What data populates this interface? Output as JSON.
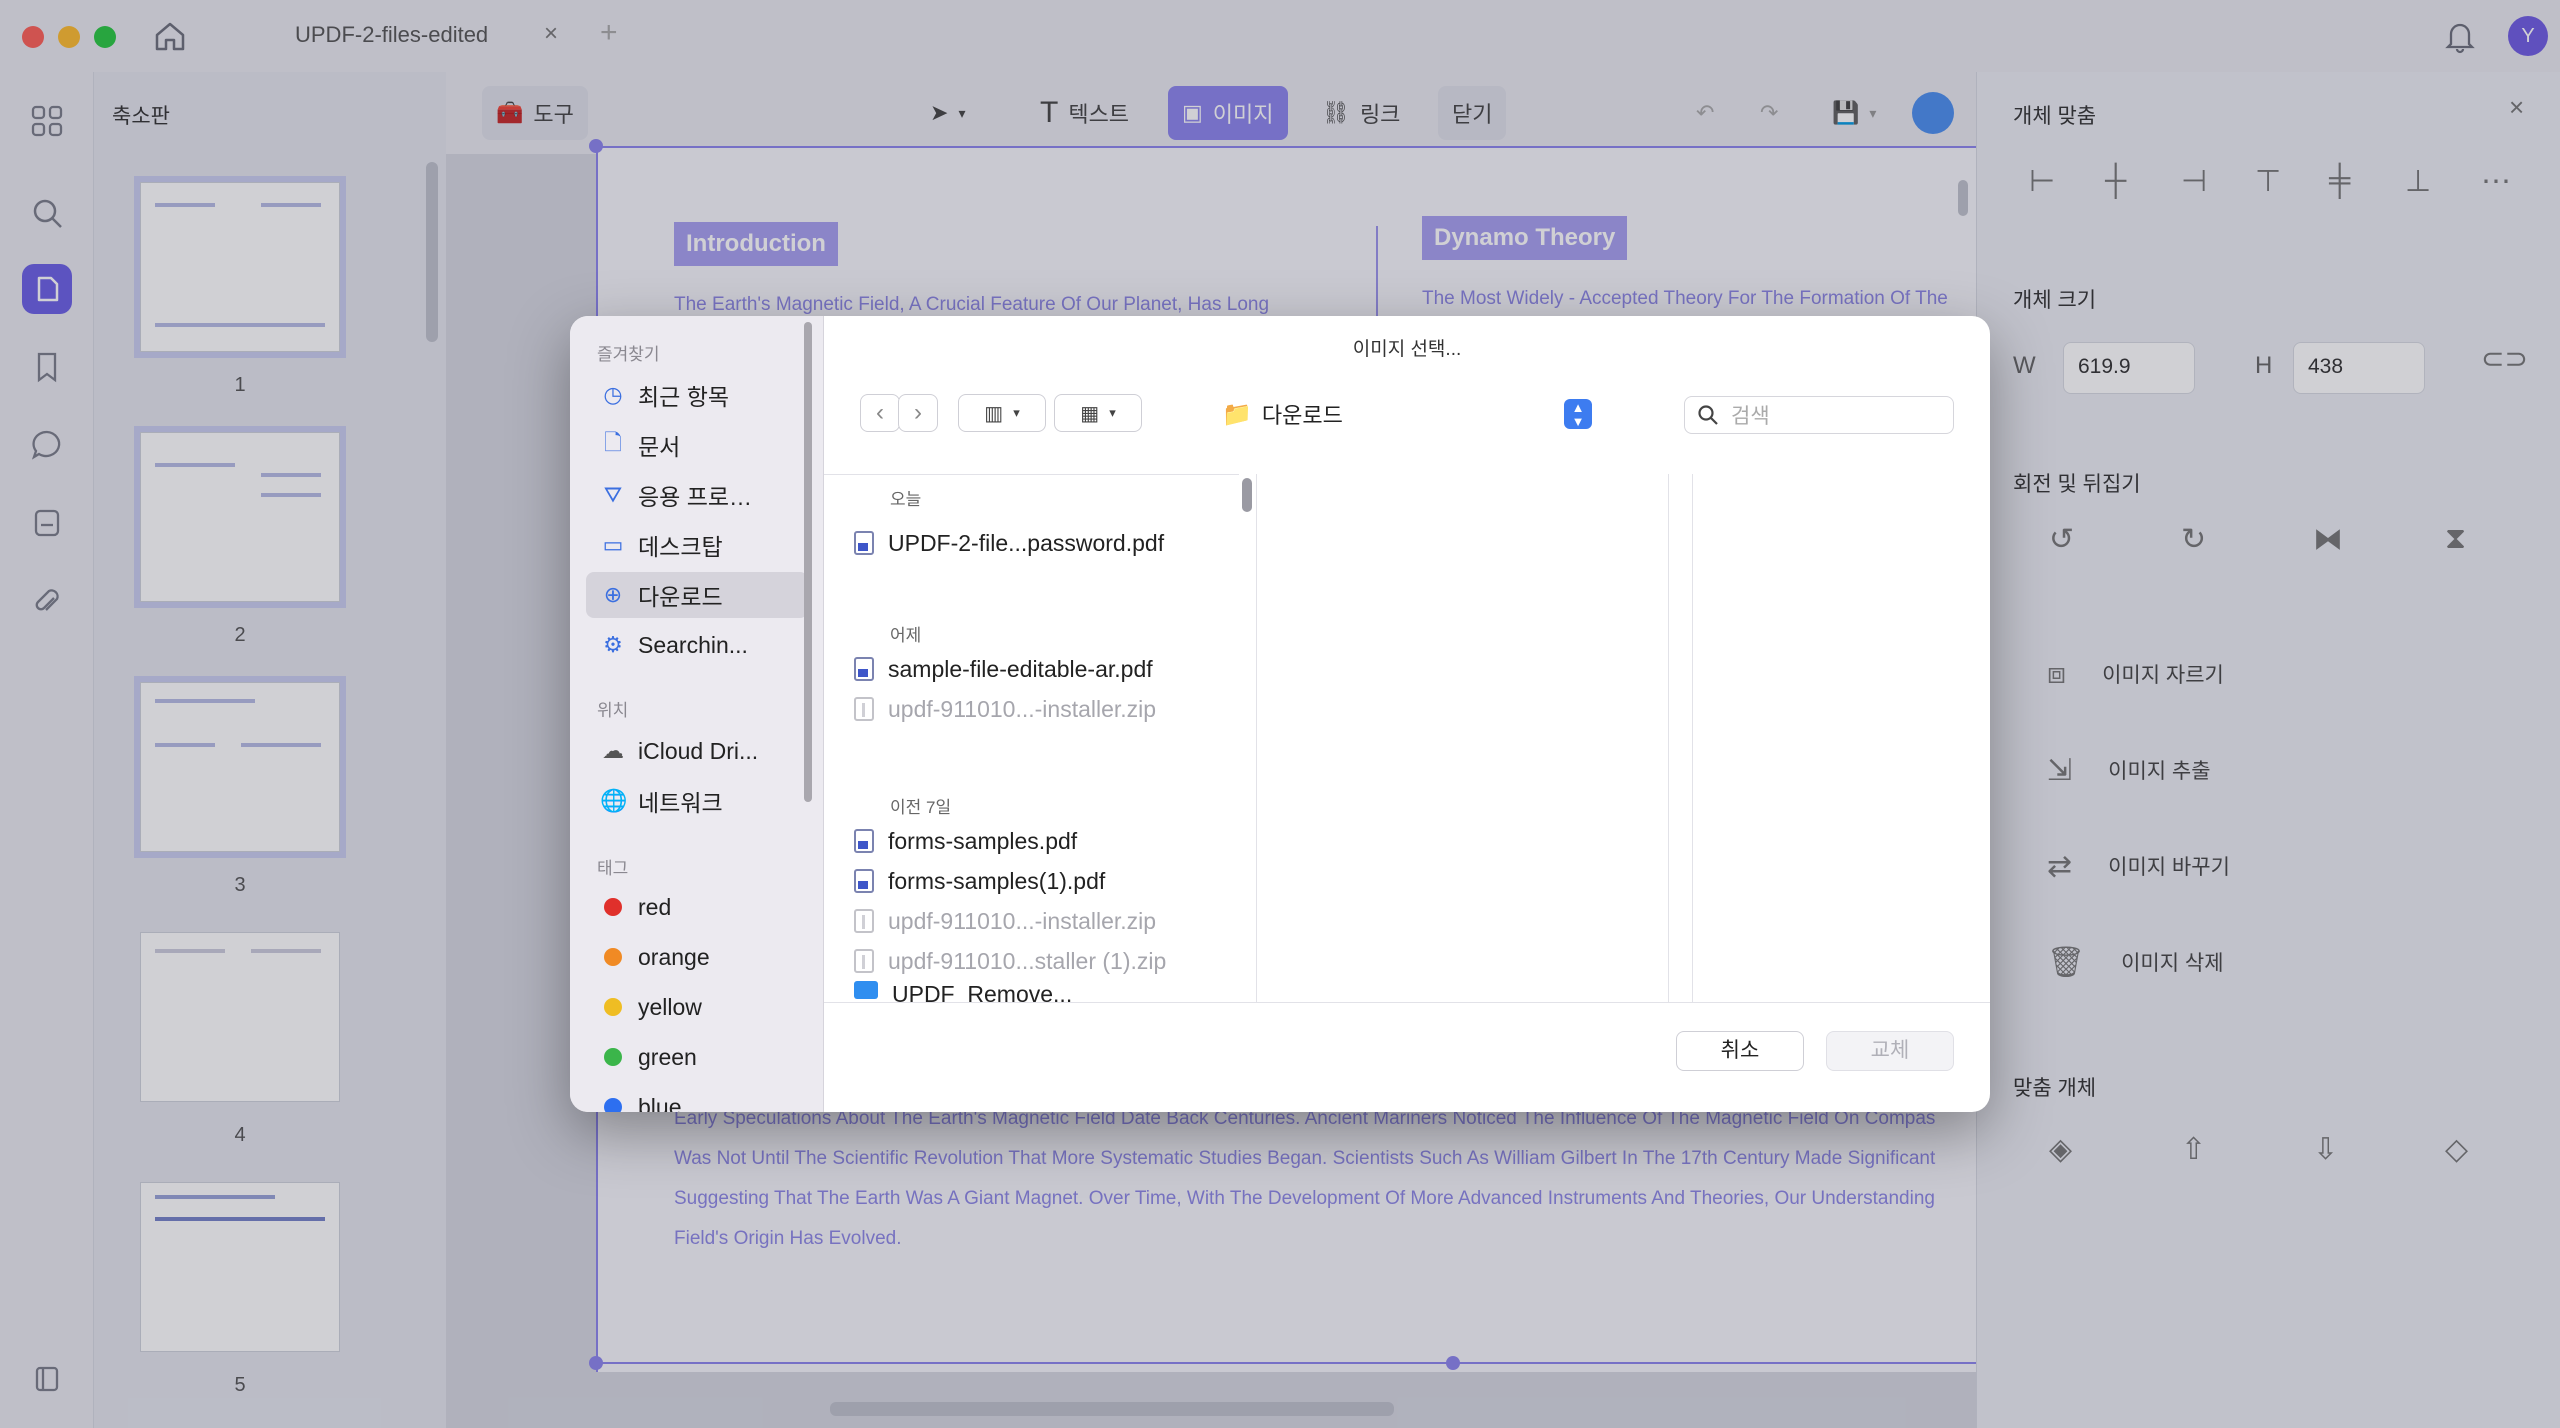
{
  "window": {
    "tab_title": "UPDF-2-files-edited",
    "tab_close": "×",
    "tab_add": "+",
    "avatar_initial": "Y"
  },
  "thumbnails": {
    "title": "축소판",
    "pages": [
      "1",
      "2",
      "3",
      "4",
      "5"
    ]
  },
  "toolbar": {
    "tool_label": "도구",
    "text_label": "텍스트",
    "image_label": "이미지",
    "link_label": "링크",
    "close_label": "닫기"
  },
  "document": {
    "intro_heading": "Introduction",
    "dynamo_heading": "Dynamo Theory",
    "intro_line": "The Earth's Magnetic Field, A Crucial Feature Of Our Planet, Has Long",
    "dynamo_line": "The Most Widely - Accepted Theory For The Formation Of The",
    "body_lines": [
      "Early Speculations About The Earth's Magnetic Field Date Back Centuries. Ancient Mariners Noticed The Influence Of The Magnetic Field On Compas",
      "Was Not Until The Scientific Revolution That More Systematic Studies Began. Scientists Such As William Gilbert In The 17th Century Made Significant",
      "Suggesting That The Earth Was A Giant Magnet. Over Time, With The Development Of More Advanced Instruments And Theories, Our Understanding",
      "Field's Origin Has Evolved."
    ]
  },
  "right_panel": {
    "align_title": "개체 맞춤",
    "size_title": "개체 크기",
    "width_label": "W",
    "width_value": "619.9",
    "height_label": "H",
    "height_value": "438",
    "rotate_title": "회전 및 뒤집기",
    "actions": [
      "이미지 자르기",
      "이미지 추출",
      "이미지 바꾸기",
      "이미지 삭제"
    ],
    "arrange_title": "맞춤 개체"
  },
  "dialog": {
    "title": "이미지 선택...",
    "sidebar": {
      "favorites_head": "즐겨찾기",
      "favorites": [
        "최근 항목",
        "문서",
        "응용 프로…",
        "데스크탑",
        "다운로드",
        "Searchin..."
      ],
      "locations_head": "위치",
      "locations": [
        "iCloud Dri...",
        "네트워크"
      ],
      "tags_head": "태그",
      "tags": [
        {
          "name": "red",
          "color": "#e0302b"
        },
        {
          "name": "orange",
          "color": "#f08a24"
        },
        {
          "name": "yellow",
          "color": "#efbd23"
        },
        {
          "name": "green",
          "color": "#3bb54a"
        },
        {
          "name": "blue",
          "color": "#2d6ff0"
        }
      ]
    },
    "location": "다운로드",
    "search_placeholder": "검색",
    "groups": [
      {
        "label": "오늘",
        "files": [
          {
            "name": "UPDF-2-file...password.pdf",
            "enabled": true
          }
        ]
      },
      {
        "label": "어제",
        "files": [
          {
            "name": "sample-file-editable-ar.pdf",
            "enabled": true
          },
          {
            "name": "updf-911010...-installer.zip",
            "enabled": false
          }
        ]
      },
      {
        "label": "이전 7일",
        "files": [
          {
            "name": "forms-samples.pdf",
            "enabled": true
          },
          {
            "name": "forms-samples(1).pdf",
            "enabled": true
          },
          {
            "name": "updf-911010...-installer.zip",
            "enabled": false
          },
          {
            "name": "updf-911010...staller (1).zip",
            "enabled": false
          },
          {
            "name": "UPDF_Remove...",
            "enabled": true
          }
        ]
      }
    ],
    "cancel_label": "취소",
    "replace_label": "교체"
  }
}
